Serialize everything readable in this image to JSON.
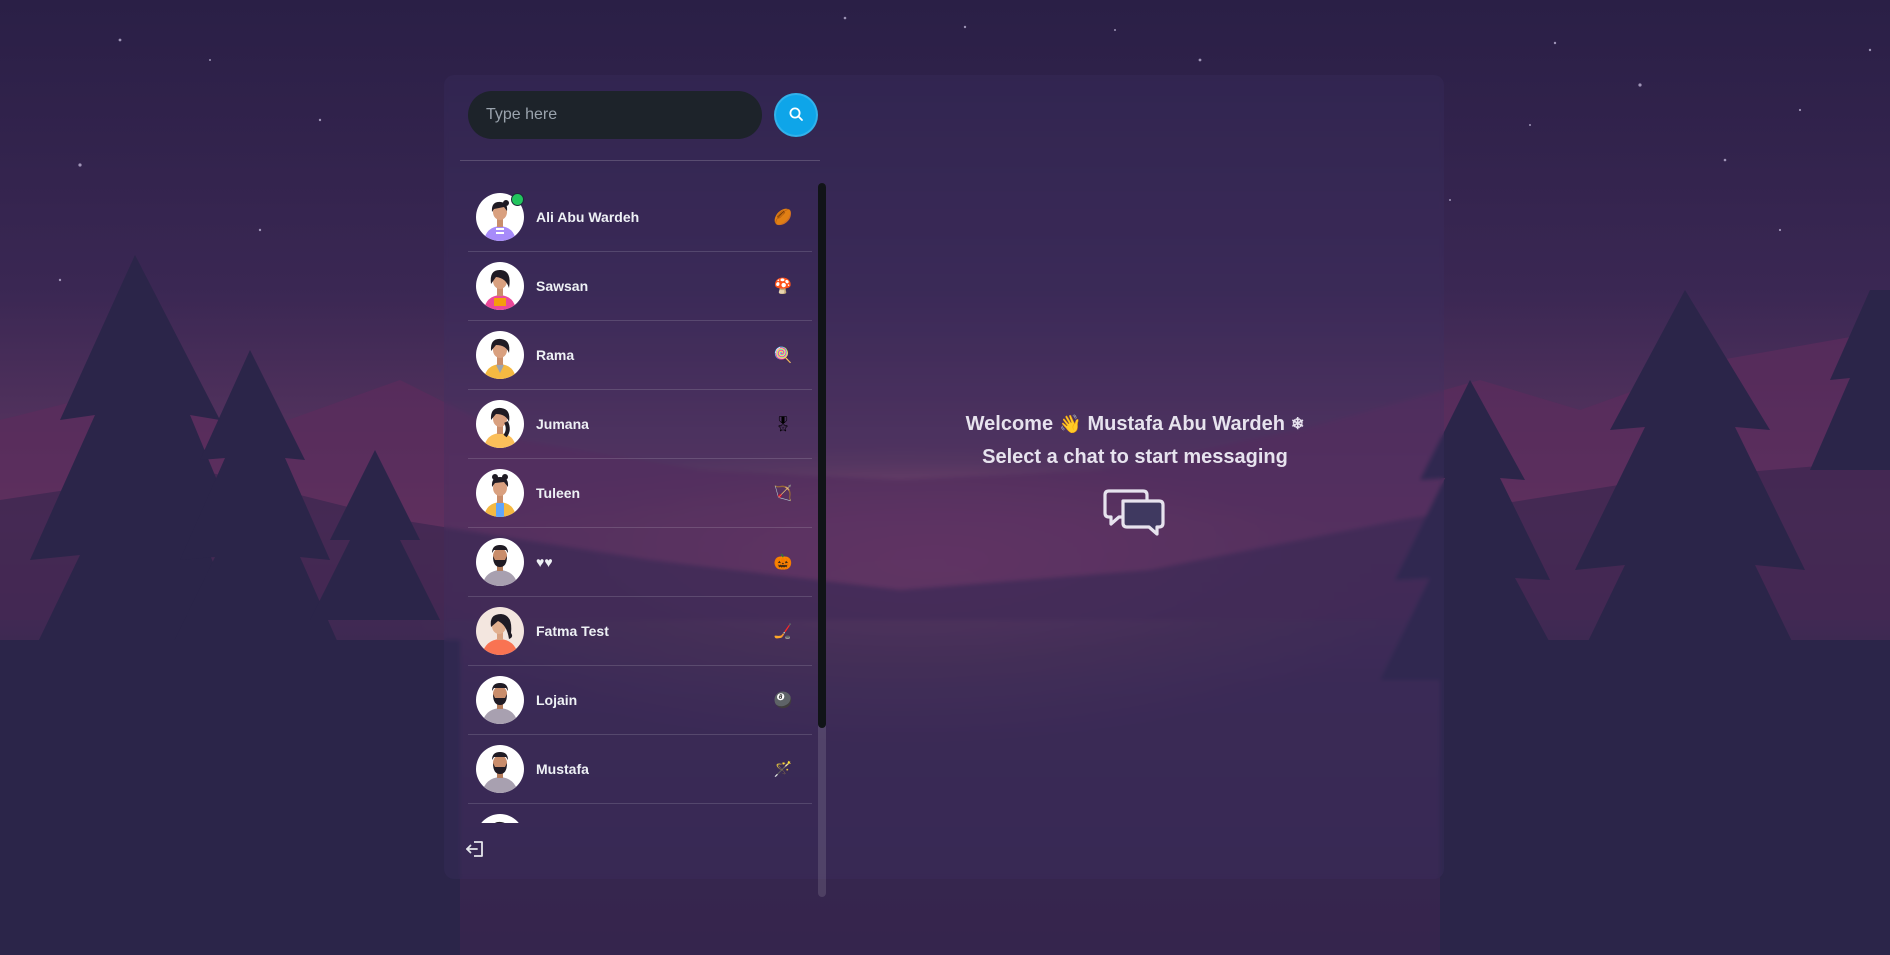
{
  "search": {
    "placeholder": "Type here"
  },
  "conversations": [
    {
      "name": "Ali Abu Wardeh",
      "emoji": "🏉",
      "online": true,
      "avatar": "girl-purple-shirt"
    },
    {
      "name": "Sawsan",
      "emoji": "🍄",
      "online": false,
      "avatar": "girl-pink-shirt"
    },
    {
      "name": "Rama",
      "emoji": "🍭",
      "online": false,
      "avatar": "girl-yellow-shirt"
    },
    {
      "name": "Jumana",
      "emoji": "🎖",
      "online": false,
      "avatar": "girl-orange-shirt"
    },
    {
      "name": "Tuleen",
      "emoji": "🏹",
      "online": false,
      "avatar": "girl-blue-overall"
    },
    {
      "name": "♥♥",
      "emoji": "🎃",
      "online": false,
      "avatar": "man-beard"
    },
    {
      "name": "Fatma Test",
      "emoji": "🏒",
      "online": false,
      "avatar": "girl-red-shirt"
    },
    {
      "name": "Lojain",
      "emoji": "🎱",
      "online": false,
      "avatar": "man-beard"
    },
    {
      "name": "Mustafa",
      "emoji": "🪄",
      "online": false,
      "avatar": "man-beard"
    }
  ],
  "welcome": {
    "greeting": "Welcome",
    "wave_emoji": "👋",
    "user_name": "Mustafa Abu Wardeh",
    "snow_emoji": "❄",
    "prompt": "Select a chat to start messaging"
  },
  "icons": {
    "search": "search-icon",
    "logout": "logout-icon",
    "chat": "chat-bubbles-icon"
  },
  "colors": {
    "accent": "#0ea5e9",
    "online": "#22c55e",
    "input_bg": "#1d232a"
  }
}
